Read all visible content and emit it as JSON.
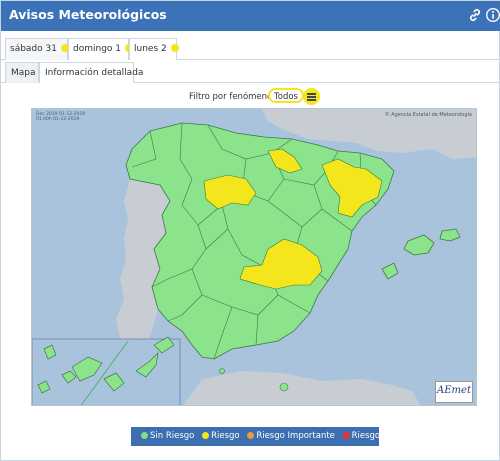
{
  "header": {
    "title": "Avisos Meteorológicos",
    "link_icon": "link-icon",
    "info_icon": "info-icon",
    "color": "#3b72b8"
  },
  "day_tabs": [
    {
      "label": "sábado 31",
      "status_color": "#f4e61c"
    },
    {
      "label": "domingo 1",
      "status_color": "#f4e61c"
    },
    {
      "label": "lunes 2",
      "status_color": "#f4e61c"
    }
  ],
  "view_tabs": [
    {
      "label": "Mapa"
    },
    {
      "label": "Información detallada"
    }
  ],
  "filter": {
    "label": "Filtro por fenómenos:",
    "selected": "Todos",
    "menu_icon": "hamburger-menu-icon"
  },
  "map": {
    "stamp_line1": "Dec 2019 01-12-2019",
    "stamp_line2": "01 00h 01-12-2019",
    "copyright": "© Agencia Estatal de Meteorología",
    "logo_text": "AEmet",
    "colors": {
      "sea": "#a9c3dc",
      "land": "#8be38b",
      "foreign": "#c8cdd3",
      "warning": "#f4e61c"
    }
  },
  "legend": {
    "items": [
      {
        "label": "Sin Riesgo",
        "color": "#7fe08a"
      },
      {
        "label": "Riesgo",
        "color": "#f4e61c"
      },
      {
        "label": "Riesgo Importante",
        "color": "#f09a3a"
      },
      {
        "label": "Riesgo Extremo",
        "color": "#e8322b"
      }
    ]
  }
}
